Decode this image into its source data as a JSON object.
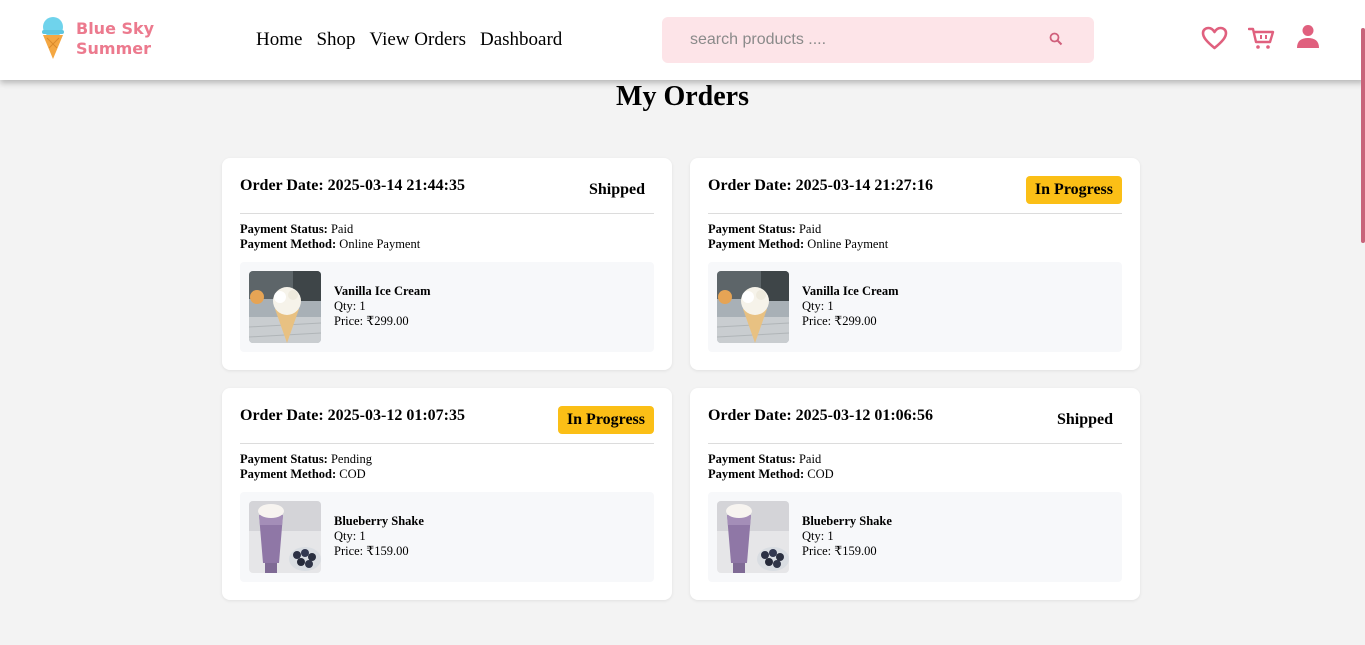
{
  "header": {
    "logo_line1": "Blue Sky",
    "logo_line2": "Summer",
    "nav": [
      "Home",
      "Shop",
      "View Orders",
      "Dashboard"
    ],
    "search_placeholder": "search products ....",
    "icons": [
      "heart-icon",
      "cart-icon",
      "user-icon"
    ],
    "accent_color": "#e0607e"
  },
  "page_title": "My Orders",
  "orders": [
    {
      "date_label": "Order Date: 2025-03-14 21:44:35",
      "status": "Shipped",
      "payment_status_label": "Payment Status:",
      "payment_status": "Paid",
      "payment_method_label": "Payment Method:",
      "payment_method": "Online Payment",
      "item_name": "Vanilla Ice Cream",
      "item_qty": "Qty: 1",
      "item_price": "Price: ₹299.00"
    },
    {
      "date_label": "Order Date: 2025-03-14 21:27:16",
      "status": "In Progress",
      "payment_status_label": "Payment Status:",
      "payment_status": "Paid",
      "payment_method_label": "Payment Method:",
      "payment_method": "Online Payment",
      "item_name": "Vanilla Ice Cream",
      "item_qty": "Qty: 1",
      "item_price": "Price: ₹299.00"
    },
    {
      "date_label": "Order Date: 2025-03-12 01:07:35",
      "status": "In Progress",
      "payment_status_label": "Payment Status:",
      "payment_status": "Pending",
      "payment_method_label": "Payment Method:",
      "payment_method": "COD",
      "item_name": "Blueberry Shake",
      "item_qty": "Qty: 1",
      "item_price": "Price: ₹159.00"
    },
    {
      "date_label": "Order Date: 2025-03-12 01:06:56",
      "status": "Shipped",
      "payment_status_label": "Payment Status:",
      "payment_status": "Paid",
      "payment_method_label": "Payment Method:",
      "payment_method": "COD",
      "item_name": "Blueberry Shake",
      "item_qty": "Qty: 1",
      "item_price": "Price: ₹159.00"
    }
  ],
  "status_colors": {
    "In Progress": "#fbbf16",
    "Shipped": "transparent"
  }
}
